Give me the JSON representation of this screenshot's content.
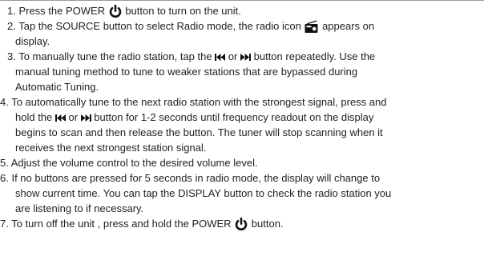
{
  "steps": [
    {
      "lines": [
        {
          "parts": [
            {
              "t": "text",
              "v": "1.  Press the POWER "
            },
            {
              "t": "icon",
              "name": "power-icon"
            },
            {
              "t": "text",
              "v": " button to turn on the unit."
            }
          ]
        }
      ]
    },
    {
      "lines": [
        {
          "parts": [
            {
              "t": "text",
              "v": "2.  Tap the SOURCE button to select Radio mode, the radio icon "
            },
            {
              "t": "icon",
              "name": "radio-icon"
            },
            {
              "t": "text",
              "v": " appears on"
            }
          ]
        },
        {
          "parts": [
            {
              "t": "text",
              "v": "display."
            }
          ]
        }
      ]
    },
    {
      "lines": [
        {
          "parts": [
            {
              "t": "text",
              "v": "3.  To manually tune the radio station, tap the "
            },
            {
              "t": "icon",
              "name": "skip-back-icon"
            },
            {
              "t": "text",
              "v": " or "
            },
            {
              "t": "icon",
              "name": "skip-forward-icon"
            },
            {
              "t": "text",
              "v": " button repeatedly. Use the"
            }
          ]
        },
        {
          "parts": [
            {
              "t": "text",
              "v": "manual tuning method to tune to weaker stations that are bypassed during"
            }
          ]
        },
        {
          "parts": [
            {
              "t": "text",
              "v": "Automatic Tuning."
            }
          ]
        }
      ]
    },
    {
      "lines": [
        {
          "parts": [
            {
              "t": "text",
              "v": "4. To automatically tune to the next radio station with the strongest signal, press and"
            }
          ]
        },
        {
          "parts": [
            {
              "t": "text",
              "v": "hold the "
            },
            {
              "t": "icon",
              "name": "skip-back-icon"
            },
            {
              "t": "text",
              "v": " or "
            },
            {
              "t": "icon",
              "name": "skip-forward-icon"
            },
            {
              "t": "text",
              "v": " button for 1-2 seconds until frequency readout on the display"
            }
          ]
        },
        {
          "parts": [
            {
              "t": "text",
              "v": "begins to scan and then release the button. The tuner will stop scanning when it"
            }
          ]
        },
        {
          "parts": [
            {
              "t": "text",
              "v": "receives the next strongest station signal."
            }
          ]
        }
      ]
    },
    {
      "lines": [
        {
          "parts": [
            {
              "t": "text",
              "v": "5. Adjust the volume control to the desired volume level."
            }
          ]
        }
      ]
    },
    {
      "lines": [
        {
          "parts": [
            {
              "t": "text",
              "v": "6. If no buttons are pressed for 5 seconds in radio mode, the display will change to"
            }
          ]
        },
        {
          "parts": [
            {
              "t": "text",
              "v": "show current time. You can tap the DISPLAY button to check the radio station you"
            }
          ]
        },
        {
          "parts": [
            {
              "t": "text",
              "v": "are listening to if necessary."
            }
          ]
        }
      ]
    },
    {
      "lines": [
        {
          "parts": [
            {
              "t": "text",
              "v": "7. To turn off the unit , press and hold the POWER "
            },
            {
              "t": "icon",
              "name": "power-icon"
            },
            {
              "t": "text",
              "v": "  button."
            }
          ]
        }
      ]
    }
  ]
}
